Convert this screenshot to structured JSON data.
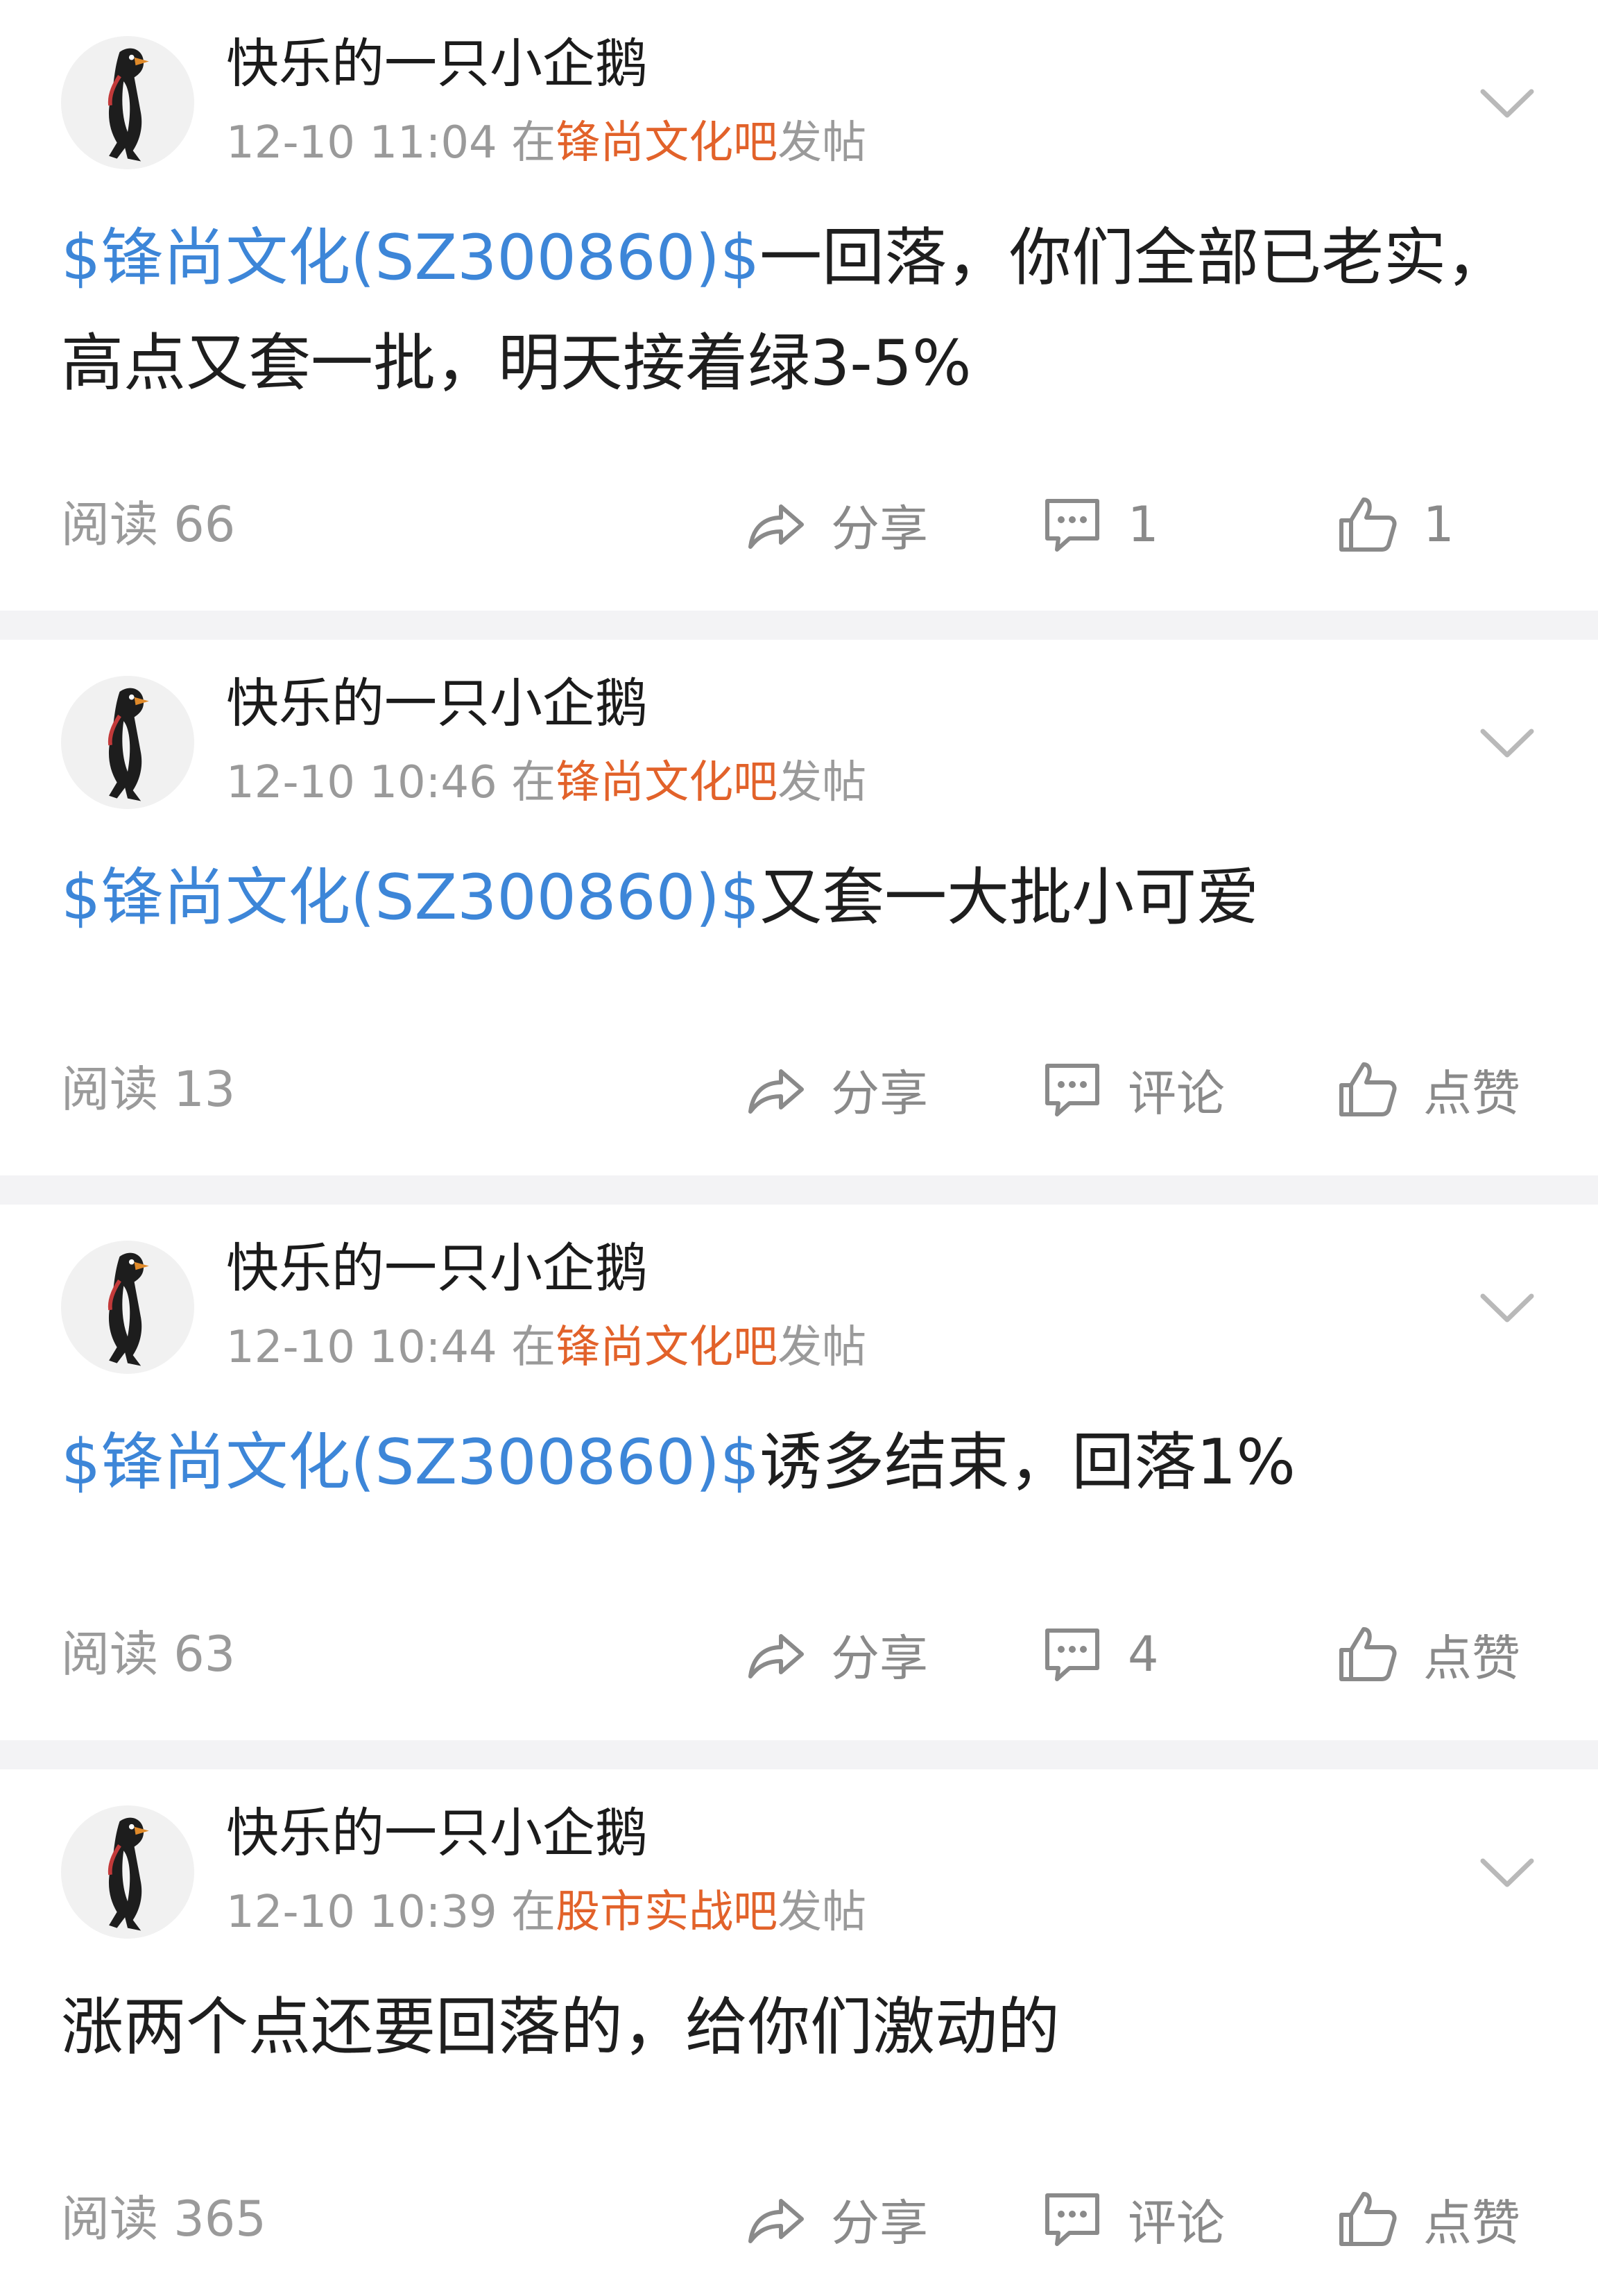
{
  "icons": {
    "avatar": "penguin-avatar-icon",
    "menu": "chevron-down-icon",
    "share": "share-arrow-icon",
    "comment": "comment-bubble-icon",
    "like": "thumbs-up-icon"
  },
  "colors": {
    "stock_link": "#3d86d8",
    "forum_link": "#e2622a",
    "meta_text": "#9a9a9a",
    "divider": "#f3f3f5"
  },
  "posts": [
    {
      "username": "快乐的一只小企鹅",
      "time": "12-10 11:04",
      "pre_forum": " 在",
      "forum": "锋尚文化吧",
      "post_suffix": "发帖",
      "stock_tag": "$锋尚文化(SZ300860)$",
      "text": "一回落，你们全部已老实，高点又套一批，明天接着绿3-5%",
      "read": "阅读 66",
      "share": "分享",
      "comment": "1",
      "like": "1"
    },
    {
      "username": "快乐的一只小企鹅",
      "time": "12-10 10:46",
      "pre_forum": " 在",
      "forum": "锋尚文化吧",
      "post_suffix": "发帖",
      "stock_tag": "$锋尚文化(SZ300860)$",
      "text": "又套一大批小可爱",
      "read": "阅读 13",
      "share": "分享",
      "comment": "评论",
      "like": "点赞"
    },
    {
      "username": "快乐的一只小企鹅",
      "time": "12-10 10:44",
      "pre_forum": " 在",
      "forum": "锋尚文化吧",
      "post_suffix": "发帖",
      "stock_tag": "$锋尚文化(SZ300860)$",
      "text": "诱多结束，回落1%",
      "read": "阅读 63",
      "share": "分享",
      "comment": "4",
      "like": "点赞"
    },
    {
      "username": "快乐的一只小企鹅",
      "time": "12-10 10:39",
      "pre_forum": " 在",
      "forum": "股市实战吧",
      "post_suffix": "发帖",
      "stock_tag": "",
      "text": "涨两个点还要回落的，给你们激动的",
      "read": "阅读 365",
      "share": "分享",
      "comment": "评论",
      "like": "点赞"
    }
  ]
}
